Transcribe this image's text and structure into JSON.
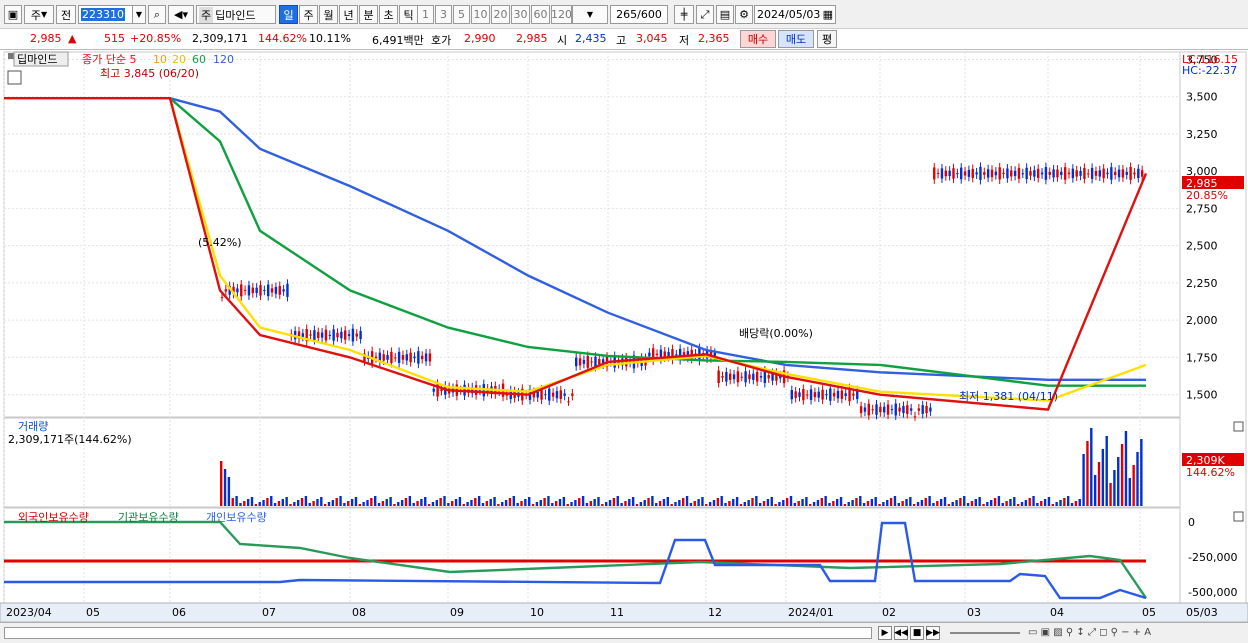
{
  "toolbar": {
    "market": "주",
    "prefix": "전",
    "code": "223310",
    "name_prefix": "주",
    "stock_name": "딥마인드",
    "periods": [
      "일",
      "주",
      "월",
      "년",
      "분",
      "초",
      "틱"
    ],
    "numbers": [
      "1",
      "3",
      "5",
      "10",
      "20",
      "30",
      "60",
      "120"
    ],
    "count": "265",
    "count_total": "/600",
    "date": "2024/05/03"
  },
  "info": {
    "price": "2,985",
    "change": "515",
    "change_pct": "+20.85%",
    "volume": "2,309,171",
    "vol_pct": "144.62%",
    "turnover": "10.11%",
    "amount": "6,491백만",
    "hoga_label": "호가",
    "ask": "2,990",
    "bid": "2,985",
    "open_label": "시",
    "open": "2,435",
    "high_label": "고",
    "high": "3,045",
    "low_label": "저",
    "low": "2,365",
    "buy": "매수",
    "sell": "매도",
    "eval": "평"
  },
  "price_pane": {
    "name_tag": "딥마인드",
    "legend_close": "종가 단순 5",
    "ma": [
      "10",
      "20",
      "60",
      "120"
    ],
    "high_note": "최고 3,845 (06/20)",
    "low_note": "최저 1,381 (04/11)",
    "dividend_note": "배당락(0.00%)",
    "pct_note": "(5.42%)",
    "lc": "LC:116.15",
    "hc": "HC:-22.37",
    "y_ticks": [
      "3,750",
      "3,500",
      "3,250",
      "3,000",
      "2,750",
      "2,500",
      "2,250",
      "2,000",
      "1,750",
      "1,500"
    ],
    "last_price": "2,985",
    "last_pct": "20.85%"
  },
  "volume_pane": {
    "title": "거래량",
    "value": "2,309,171주(144.62%)",
    "last": "2,309K",
    "last_pct": "144.62%"
  },
  "holdings_pane": {
    "foreign": "외국인보유수량",
    "inst": "기관보유수량",
    "indiv": "개인보유수량",
    "y_ticks": [
      "0",
      "-250,000",
      "-500,000"
    ]
  },
  "x_axis": [
    "2023/04",
    "05",
    "06",
    "07",
    "08",
    "09",
    "10",
    "11",
    "12",
    "2024/01",
    "02",
    "03",
    "04",
    "05",
    "05/03"
  ],
  "colors": {
    "up": "#e00000",
    "down": "#0030d0",
    "ma5": "#e01010",
    "ma10": "#ff9a00",
    "ma20": "#ffe000",
    "ma60": "#10a040",
    "ma120": "#3060e0"
  },
  "chart_data": {
    "type": "line",
    "x_range": [
      "2023-04",
      "2024-05-03"
    ],
    "price_series": [
      {
        "name": "120",
        "values": [
          3490,
          3490,
          3490,
          3400,
          3150,
          2900,
          2600,
          2300,
          2050,
          1800,
          1700,
          1650,
          1600,
          1600
        ]
      },
      {
        "name": "60",
        "values": [
          3490,
          3490,
          3490,
          3200,
          2600,
          2200,
          1950,
          1820,
          1760,
          1730,
          1720,
          1700,
          1560,
          1560
        ]
      },
      {
        "name": "20",
        "values": [
          3490,
          3490,
          3490,
          2300,
          1950,
          1800,
          1550,
          1520,
          1700,
          1760,
          1640,
          1520,
          1460,
          1700
        ]
      },
      {
        "name": "5",
        "values": [
          3490,
          3490,
          3490,
          2200,
          1900,
          1750,
          1530,
          1500,
          1720,
          1770,
          1620,
          1500,
          1400,
          2985
        ]
      }
    ],
    "ylim": [
      1350,
      3800
    ]
  }
}
